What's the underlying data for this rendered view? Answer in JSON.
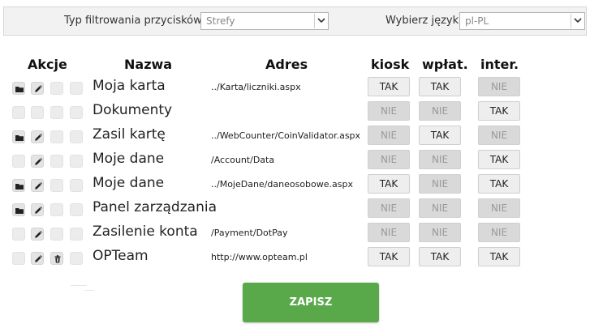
{
  "filter": {
    "type_label": "Typ filtrowania przycisków:",
    "type_value": "Strefy",
    "lang_label": "Wybierz język:",
    "lang_value": "pl-PL"
  },
  "headers": {
    "actions": "Akcje",
    "name": "Nazwa",
    "address": "Adres",
    "kiosk": "kiosk",
    "wplat": "wpłat.",
    "inter": "inter."
  },
  "rows": [
    {
      "name": "Moja karta",
      "address": "../Karta/liczniki.aspx",
      "icons": [
        "folder",
        "edit",
        "",
        ""
      ],
      "kiosk": "TAK",
      "wplat": "TAK",
      "inter": "NIE"
    },
    {
      "name": "Dokumenty",
      "address": "",
      "icons": [
        "",
        "",
        "",
        ""
      ],
      "kiosk": "NIE",
      "wplat": "NIE",
      "inter": "TAK"
    },
    {
      "name": "Zasil kartę",
      "address": "../WebCounter/CoinValidator.aspx",
      "icons": [
        "folder",
        "edit",
        "",
        ""
      ],
      "kiosk": "NIE",
      "wplat": "TAK",
      "inter": "NIE"
    },
    {
      "name": "Moje dane",
      "address": "/Account/Data",
      "icons": [
        "",
        "edit",
        "",
        ""
      ],
      "kiosk": "NIE",
      "wplat": "NIE",
      "inter": "TAK"
    },
    {
      "name": "Moje dane",
      "address": "../MojeDane/daneosobowe.aspx",
      "icons": [
        "folder",
        "edit",
        "",
        ""
      ],
      "kiosk": "TAK",
      "wplat": "NIE",
      "inter": "TAK"
    },
    {
      "name": "Panel zarządzania",
      "address": "",
      "icons": [
        "folder",
        "edit",
        "",
        ""
      ],
      "kiosk": "NIE",
      "wplat": "NIE",
      "inter": "NIE"
    },
    {
      "name": "Zasilenie konta",
      "address": "/Payment/DotPay",
      "icons": [
        "",
        "edit",
        "",
        ""
      ],
      "kiosk": "NIE",
      "wplat": "NIE",
      "inter": "NIE"
    },
    {
      "name": "OPTeam",
      "address": "http://www.opteam.pl",
      "icons": [
        "",
        "edit",
        "trash",
        ""
      ],
      "kiosk": "TAK",
      "wplat": "TAK",
      "inter": "TAK"
    }
  ],
  "save_label": "ZAPISZ"
}
